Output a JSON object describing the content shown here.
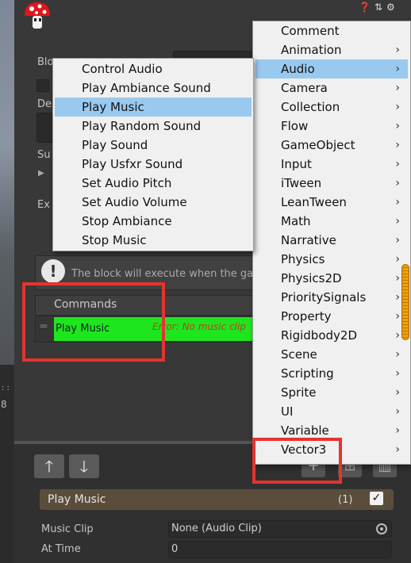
{
  "scene": {
    "left_number": "8",
    "dots": ": :"
  },
  "inspector": {
    "top_icons": [
      "help-icon",
      "preset-icon",
      "settings-icon"
    ],
    "labels": [
      "Blo",
      "De",
      "Su",
      "Ex"
    ],
    "info_text": "The block will execute when the gam",
    "commands_header": "Commands",
    "command": {
      "name": "Play Music",
      "error": "Error: No music clip"
    }
  },
  "category_menu": {
    "items": [
      {
        "label": "Comment",
        "submenu": false
      },
      {
        "label": "Animation",
        "submenu": true
      },
      {
        "label": "Audio",
        "submenu": true,
        "active": true
      },
      {
        "label": "Camera",
        "submenu": true
      },
      {
        "label": "Collection",
        "submenu": true
      },
      {
        "label": "Flow",
        "submenu": true
      },
      {
        "label": "GameObject",
        "submenu": true
      },
      {
        "label": "Input",
        "submenu": true
      },
      {
        "label": "iTween",
        "submenu": true
      },
      {
        "label": "LeanTween",
        "submenu": true
      },
      {
        "label": "Math",
        "submenu": true
      },
      {
        "label": "Narrative",
        "submenu": true
      },
      {
        "label": "Physics",
        "submenu": true
      },
      {
        "label": "Physics2D",
        "submenu": true
      },
      {
        "label": "PrioritySignals",
        "submenu": true
      },
      {
        "label": "Property",
        "submenu": true
      },
      {
        "label": "Rigidbody2D",
        "submenu": true
      },
      {
        "label": "Scene",
        "submenu": true
      },
      {
        "label": "Scripting",
        "submenu": true
      },
      {
        "label": "Sprite",
        "submenu": true
      },
      {
        "label": "UI",
        "submenu": true
      },
      {
        "label": "Variable",
        "submenu": true
      },
      {
        "label": "Vector3",
        "submenu": true
      }
    ]
  },
  "audio_menu": {
    "items": [
      {
        "label": "Control Audio"
      },
      {
        "label": "Play Ambiance Sound"
      },
      {
        "label": "Play Music",
        "active": true
      },
      {
        "label": "Play Random Sound"
      },
      {
        "label": "Play Sound"
      },
      {
        "label": "Play Usfxr Sound"
      },
      {
        "label": "Set Audio Pitch"
      },
      {
        "label": "Set Audio Volume"
      },
      {
        "label": "Stop Ambiance"
      },
      {
        "label": "Stop Music"
      }
    ]
  },
  "bottom": {
    "up_glyph": "🡑",
    "down_glyph": "🡓",
    "add_glyph": "+",
    "command_title": "Play Music",
    "command_count": "(1)",
    "enabled": true,
    "fields": {
      "music_clip_label": "Music Clip",
      "music_clip_value": "None (Audio Clip)",
      "at_time_label": "At Time",
      "at_time_value": "0"
    }
  },
  "colors": {
    "command_green": "#1ee61e",
    "highlight_red": "#e3342f",
    "menu_active": "#99c9ef",
    "command_bar": "#5b4d3b"
  }
}
